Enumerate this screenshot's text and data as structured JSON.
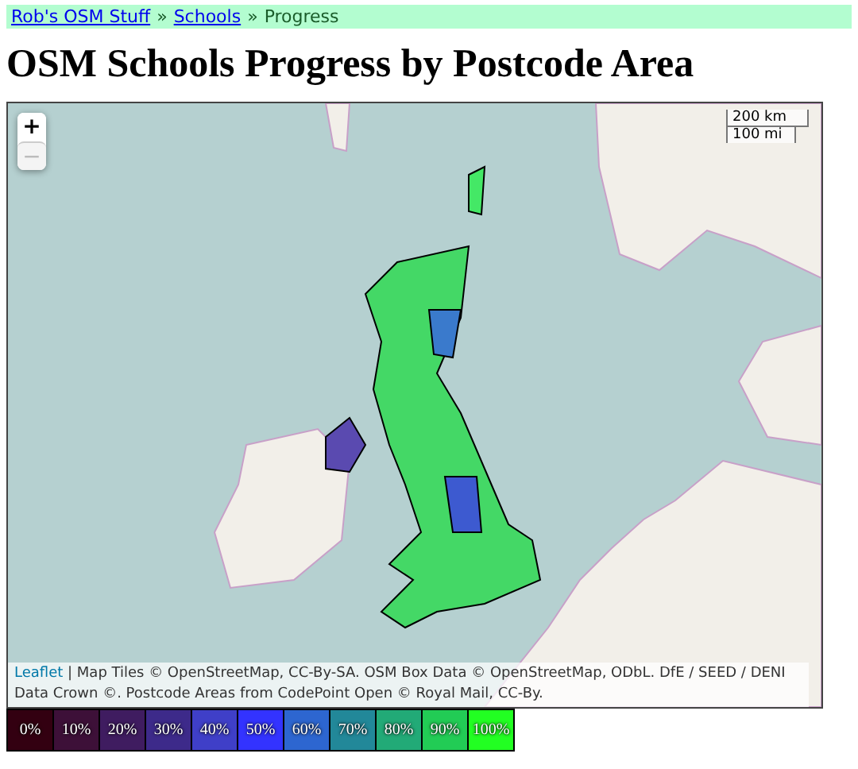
{
  "breadcrumb": {
    "links": [
      "Rob's OSM Stuff",
      "Schools"
    ],
    "separator": "»",
    "current": "Progress"
  },
  "title": "OSM Schools Progress by Postcode Area",
  "map": {
    "zoom_in": "+",
    "zoom_out": "−",
    "zoom_out_disabled": true,
    "scale": [
      "200 km",
      "100 mi"
    ],
    "attribution": {
      "link": "Leaflet",
      "text": "| Map Tiles © OpenStreetMap, CC-By-SA. OSM Box Data © OpenStreetMap, ODbL. DfE / SEED / DENI Data Crown ©. Postcode Areas from CodePoint Open © Royal Mail, CC-By."
    }
  },
  "legend": [
    {
      "label": "0%",
      "color": "#330011"
    },
    {
      "label": "10%",
      "color": "#3d1038"
    },
    {
      "label": "20%",
      "color": "#3f1c60"
    },
    {
      "label": "30%",
      "color": "#3d2a8a"
    },
    {
      "label": "40%",
      "color": "#3f3fc8"
    },
    {
      "label": "50%",
      "color": "#3333ff"
    },
    {
      "label": "60%",
      "color": "#2d66d0"
    },
    {
      "label": "70%",
      "color": "#228899"
    },
    {
      "label": "80%",
      "color": "#22aa77"
    },
    {
      "label": "90%",
      "color": "#22cc55"
    },
    {
      "label": "100%",
      "color": "#22ff22"
    }
  ]
}
